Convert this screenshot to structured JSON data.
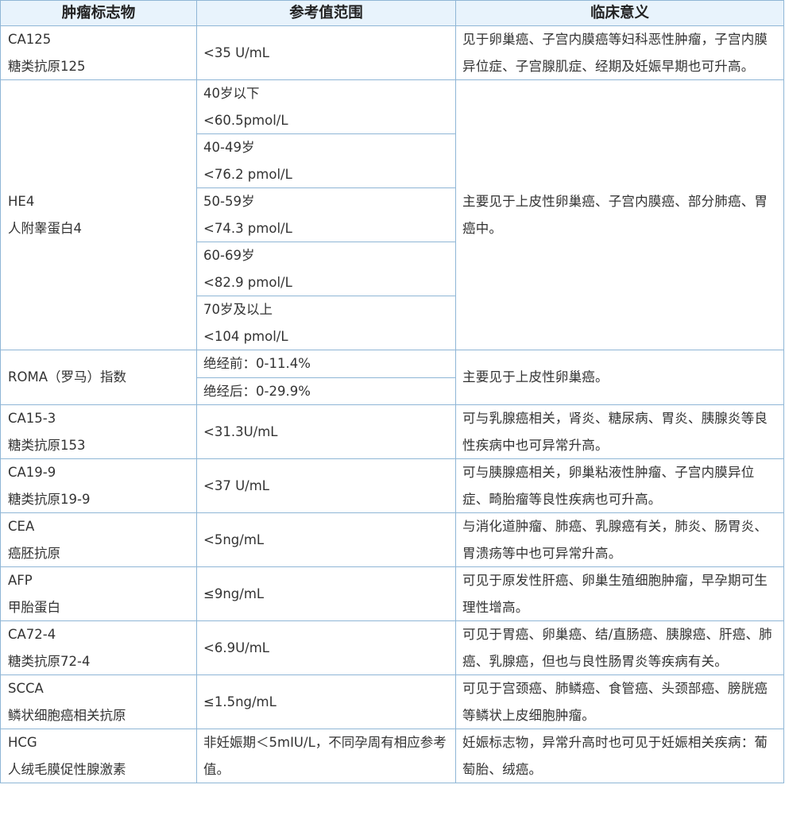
{
  "table": {
    "headers": [
      "肿瘤标志物",
      "参考值范围",
      "临床意义"
    ],
    "rows": [
      {
        "name": [
          "CA125",
          "糖类抗原125"
        ],
        "ranges": [
          [
            "<35 U/mL"
          ]
        ],
        "significance": "见于卵巢癌、子宫内膜癌等妇科恶性肿瘤，子宫内膜异位症、子宫腺肌症、经期及妊娠早期也可升高。"
      },
      {
        "name": [
          "HE4",
          "人附睾蛋白4"
        ],
        "ranges": [
          [
            "40岁以下",
            "<60.5pmol/L"
          ],
          [
            "40-49岁",
            "<76.2 pmol/L"
          ],
          [
            "50-59岁",
            "<74.3 pmol/L"
          ],
          [
            "60-69岁",
            "<82.9 pmol/L"
          ],
          [
            "70岁及以上",
            "<104 pmol/L"
          ]
        ],
        "significance": "主要见于上皮性卵巢癌、子宫内膜癌、部分肺癌、胃癌中。"
      },
      {
        "name": [
          "ROMA（罗马）指数"
        ],
        "ranges": [
          [
            "绝经前：0-11.4%"
          ],
          [
            "绝经后：0-29.9%"
          ]
        ],
        "significance": "主要见于上皮性卵巢癌。"
      },
      {
        "name": [
          "CA15-3",
          "糖类抗原153"
        ],
        "ranges": [
          [
            "<31.3U/mL"
          ]
        ],
        "significance": "可与乳腺癌相关，肾炎、糖尿病、胃炎、胰腺炎等良性疾病中也可异常升高。"
      },
      {
        "name": [
          "CA19-9",
          "糖类抗原19-9"
        ],
        "ranges": [
          [
            "<37 U/mL"
          ]
        ],
        "significance": "可与胰腺癌相关，卵巢粘液性肿瘤、子宫内膜异位症、畸胎瘤等良性疾病也可升高。"
      },
      {
        "name": [
          "CEA",
          "癌胚抗原"
        ],
        "ranges": [
          [
            "<5ng/mL"
          ]
        ],
        "significance": "与消化道肿瘤、肺癌、乳腺癌有关，肺炎、肠胃炎、胃溃疡等中也可异常升高。"
      },
      {
        "name": [
          "AFP",
          "甲胎蛋白"
        ],
        "ranges": [
          [
            "≤9ng/mL"
          ]
        ],
        "significance": "可见于原发性肝癌、卵巢生殖细胞肿瘤，早孕期可生理性增高。"
      },
      {
        "name": [
          "CA72-4",
          "糖类抗原72-4"
        ],
        "ranges": [
          [
            "<6.9U/mL"
          ]
        ],
        "significance": "可见于胃癌、卵巢癌、结/直肠癌、胰腺癌、肝癌、肺癌、乳腺癌，但也与良性肠胃炎等疾病有关。"
      },
      {
        "name": [
          "SCCA",
          "鳞状细胞癌相关抗原"
        ],
        "ranges": [
          [
            "≤1.5ng/mL"
          ]
        ],
        "significance": "可见于宫颈癌、肺鳞癌、食管癌、头颈部癌、膀胱癌等鳞状上皮细胞肿瘤。"
      },
      {
        "name": [
          "HCG",
          "人绒毛膜促性腺激素"
        ],
        "ranges": [
          [
            "非妊娠期＜5mIU/L，不同孕周有相应参考值。"
          ]
        ],
        "significance": "妊娠标志物，异常升高时也可见于妊娠相关疾病：葡萄胎、绒癌。"
      }
    ]
  }
}
